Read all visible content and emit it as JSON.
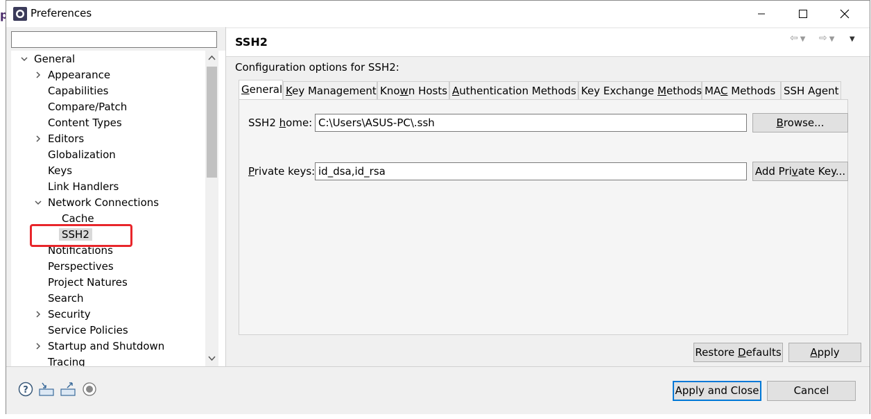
{
  "window": {
    "title": "Preferences"
  },
  "stray_glyph": "p",
  "filter": {
    "value": ""
  },
  "tree": [
    {
      "label": "General",
      "expanded": true
    },
    {
      "label": "Appearance"
    },
    {
      "label": "Capabilities"
    },
    {
      "label": "Compare/Patch"
    },
    {
      "label": "Content Types"
    },
    {
      "label": "Editors"
    },
    {
      "label": "Globalization"
    },
    {
      "label": "Keys"
    },
    {
      "label": "Link Handlers"
    },
    {
      "label": "Network Connections",
      "expanded": true
    },
    {
      "label": "Cache"
    },
    {
      "label": "SSH2",
      "selected": true
    },
    {
      "label": "Notifications"
    },
    {
      "label": "Perspectives"
    },
    {
      "label": "Project Natures"
    },
    {
      "label": "Search"
    },
    {
      "label": "Security"
    },
    {
      "label": "Service Policies"
    },
    {
      "label": "Startup and Shutdown"
    },
    {
      "label": "Tracing"
    }
  ],
  "page": {
    "title": "SSH2",
    "description": "Configuration options for SSH2:",
    "tabs": [
      {
        "pre": "",
        "u": "G",
        "post": "eneral"
      },
      {
        "pre": "",
        "u": "K",
        "post": "ey Management"
      },
      {
        "pre": "Kno",
        "u": "w",
        "post": "n Hosts"
      },
      {
        "pre": "",
        "u": "A",
        "post": "uthentication Methods"
      },
      {
        "pre": "Key Exchange ",
        "u": "M",
        "post": "ethods"
      },
      {
        "pre": "MA",
        "u": "C",
        "post": " Methods"
      },
      {
        "pre": "SSH Agent",
        "u": "",
        "post": ""
      }
    ],
    "ssh_home": {
      "label_pre": "SSH2 ",
      "label_u": "h",
      "label_post": "ome:",
      "value": "C:\\Users\\ASUS-PC\\.ssh"
    },
    "browse": {
      "pre": "",
      "u": "B",
      "post": "rowse..."
    },
    "private_keys": {
      "label_pre": "",
      "label_u": "P",
      "label_post": "rivate keys:",
      "value": "id_dsa,id_rsa"
    },
    "add_key": {
      "pre": "Add Pri",
      "u": "v",
      "post": "ate Key..."
    },
    "restore": {
      "pre": "Restore ",
      "u": "D",
      "post": "efaults"
    },
    "apply": {
      "pre": "",
      "u": "A",
      "post": "pply"
    }
  },
  "footer": {
    "apply_close": "Apply and Close",
    "cancel": "Cancel"
  },
  "colors": {
    "highlight_box": "#e8262b",
    "default_button_border": "#0078d7"
  }
}
